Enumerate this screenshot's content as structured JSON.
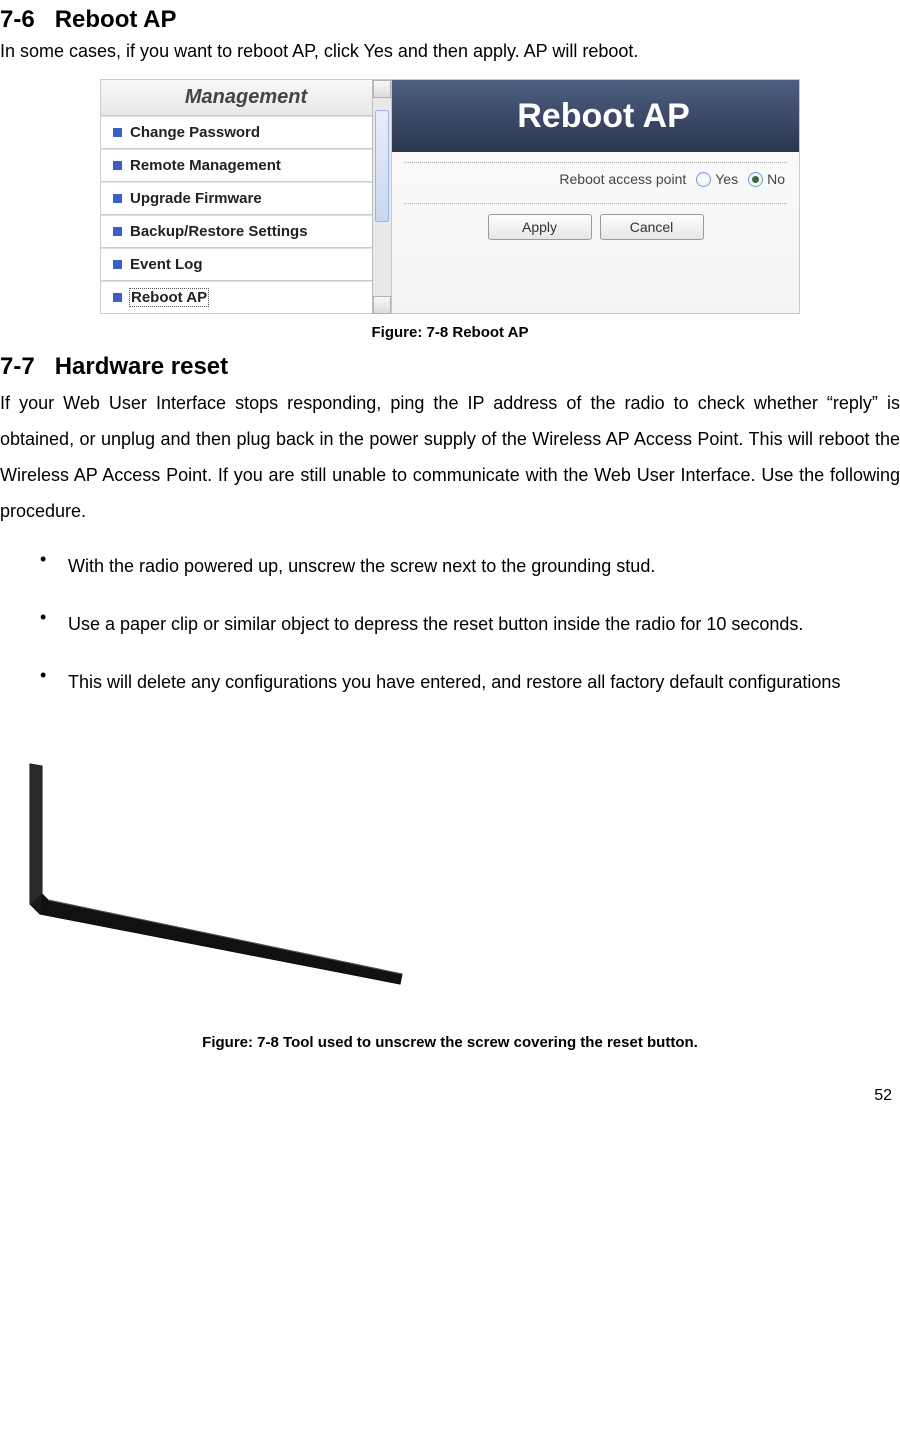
{
  "section1": {
    "number": "7-6",
    "title": "Reboot AP",
    "intro": "In some cases, if you want to reboot AP, click Yes and then apply. AP will reboot."
  },
  "fig1": {
    "caption": "Figure: 7-8 Reboot AP",
    "sidebar_title": "Management",
    "sidebar_items": [
      "Change Password",
      "Remote Management",
      "Upgrade Firmware",
      "Backup/Restore Settings",
      "Event Log",
      "Reboot AP"
    ],
    "banner": "Reboot AP",
    "setting_label": "Reboot access point",
    "opt_yes": "Yes",
    "opt_no": "No",
    "btn_apply": "Apply",
    "btn_cancel": "Cancel"
  },
  "section2": {
    "number": "7-7",
    "title": "Hardware reset",
    "body": "If your Web User Interface stops responding, ping the IP address of the radio to check whether “reply” is obtained, or unplug and then plug back in the power supply of the Wireless AP Access Point. This will reboot the Wireless AP Access Point. If you are still unable to communicate with the Web User Interface. Use the following procedure.",
    "bullets": [
      "With the radio powered up, unscrew the screw next to the grounding stud.",
      "Use a paper clip or similar object to depress the reset button inside the radio for 10 seconds.",
      "This will delete any configurations you have entered, and restore all factory default configurations"
    ]
  },
  "fig2": {
    "caption": "Figure: 7-8 Tool used to unscrew the screw covering the reset button."
  },
  "page_number": "52"
}
